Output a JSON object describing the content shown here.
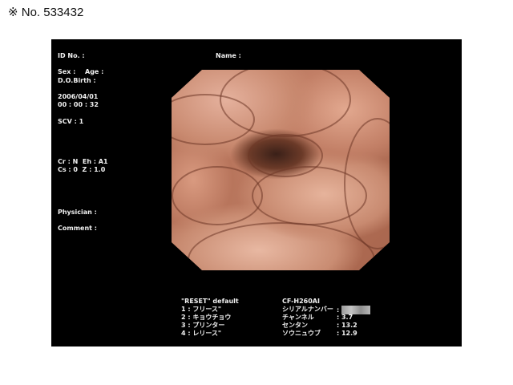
{
  "reference": "※ No. 533432",
  "patient": {
    "id_label": "ID No. :",
    "name_label": "Name :",
    "sex_label": "Sex :",
    "age_label": "Age :",
    "dob_label": "D.O.Birth :",
    "date": "2006/04/01",
    "time": "00 : 00 : 32",
    "scv": "SCV : 1",
    "cr_line": "Cr : N  Eh : A1",
    "cs_line": "Cs : 0  Z : 1.0",
    "physician_label": "Physician :",
    "comment_label": "Comment :"
  },
  "menu": {
    "header": "\"RESET\" default",
    "items": [
      "1 : フリース\"",
      "2 : キョウチョウ",
      "3 : プリンター",
      "4 : レリース\""
    ]
  },
  "scope": {
    "model": "CF-H260AI",
    "rows": [
      {
        "label": "シリアルナンバー",
        "value": ""
      },
      {
        "label": "チャンネル",
        "value": "3.7"
      },
      {
        "label": "センタン",
        "value": "13.2"
      },
      {
        "label": "ソウニュウブ",
        "value": "12.9"
      }
    ]
  }
}
